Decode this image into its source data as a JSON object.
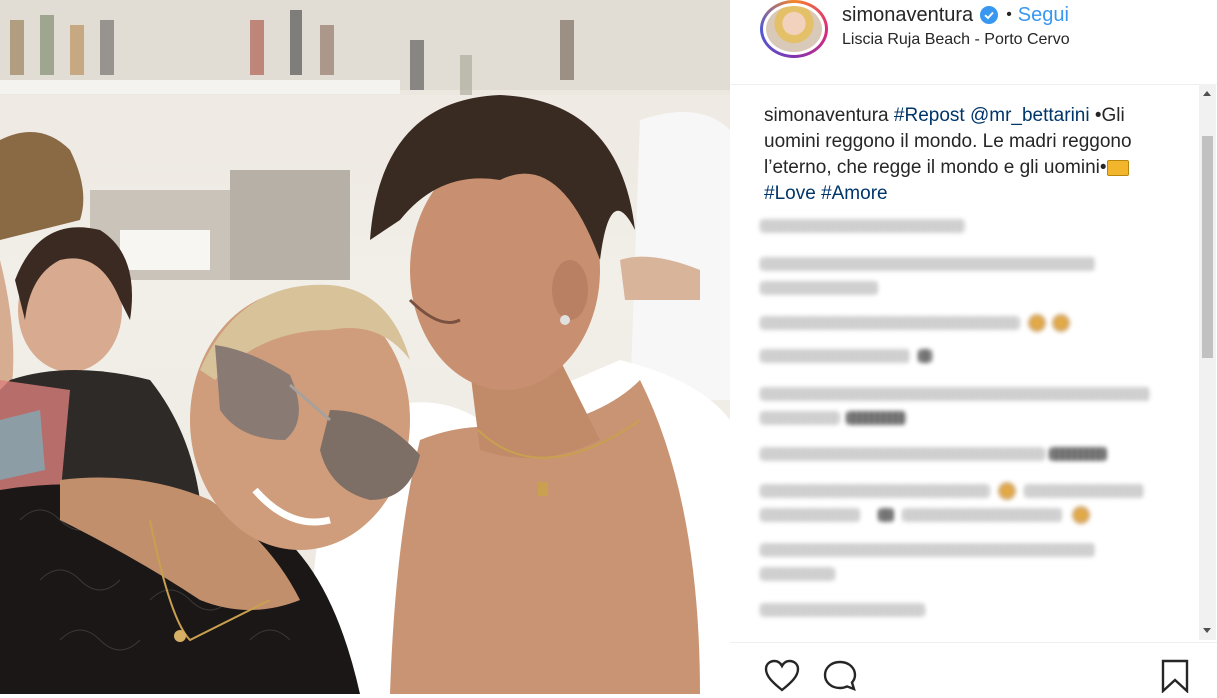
{
  "post": {
    "photo_alt": "Post photo",
    "header": {
      "username": "simonaventura",
      "separator": "•",
      "follow_label": "Segui",
      "location": "Liscia Ruja Beach - Porto Cervo"
    },
    "caption": {
      "username": "simonaventura",
      "tag_repost": "#Repost",
      "mention": "@mr_bettarini",
      "text_1": " •Gli uomini reggono il mondo. Le madri reggono l’eterno, che regge il mondo e gli uomini•",
      "tag_love": "#Love",
      "tag_amore": "#Amore"
    },
    "actions": {
      "like_icon": "heart-icon",
      "comment_icon": "comment-icon",
      "save_icon": "bookmark-icon"
    },
    "colors": {
      "link": "#003569",
      "follow": "#3897f0",
      "verified": "#3897f0"
    }
  }
}
